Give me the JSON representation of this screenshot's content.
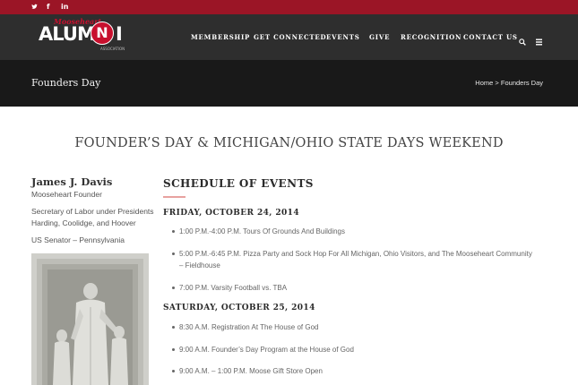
{
  "topbar": {
    "social": [
      {
        "name": "twitter",
        "glyph": "𝕥"
      },
      {
        "name": "facebook",
        "glyph": "f"
      },
      {
        "name": "linkedin",
        "glyph": "in"
      }
    ]
  },
  "logo": {
    "tagline": "Mooseheart",
    "word": "ALUM",
    "circle_letter": "N",
    "word_end": "I",
    "sub": "ASSOCIATION"
  },
  "nav": {
    "items": [
      "MEMBERSHIP",
      "GET CONNECTED",
      "EVENTS",
      "GIVE",
      "RECOGNITION",
      "CONTACT US"
    ],
    "search_icon": "search-icon",
    "menu_icon": "menu-icon"
  },
  "titlebar": {
    "title": "Founders Day",
    "breadcrumb_home": "Home",
    "breadcrumb_sep": ">",
    "breadcrumb_current": "Founders Day"
  },
  "main": {
    "heading": "FOUNDER’S DAY & MICHIGAN/OHIO STATE DAYS WEEKEND"
  },
  "sidebar": {
    "name": "James J. Davis",
    "role": "Mooseheart Founder",
    "bio_line1": "Secretary of Labor under Presidents",
    "bio_line2": "Harding, Coolidge, and Hoover",
    "bio_line3": "US Senator – Pennsylvania"
  },
  "schedule": {
    "title": "SCHEDULE OF EVENTS",
    "days": [
      {
        "label": "FRIDAY, OCTOBER 24, 2014",
        "events": [
          "1:00 P.M.-4:00 P.M. Tours Of Grounds And Buildings",
          "5:00 P.M.-6:45 P.M. Pizza Party and Sock Hop For All Michigan, Ohio Visitors, and The Mooseheart Community",
          "– Fieldhouse",
          "7:00 P.M. Varsity Football vs. TBA"
        ]
      },
      {
        "label": "SATURDAY, OCTOBER 25, 2014",
        "events": [
          "8:30 A.M. Registration At The House of God",
          "9:00 A.M. Founder’s Day Program at the House of God",
          "9:00 A.M. – 1:00 P.M. Moose Gift Store Open"
        ]
      }
    ]
  },
  "colors": {
    "topbar": "#9b1526",
    "navbar": "#2e2e2e",
    "titlebar": "#191919",
    "accent": "#e8a2a0",
    "logo_red": "#c8102e"
  }
}
